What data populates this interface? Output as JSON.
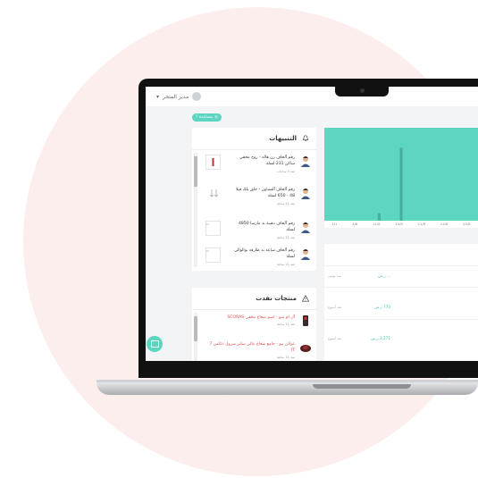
{
  "header": {
    "user_name": "مدير المتجر"
  },
  "badge": {
    "label": "مساعدة ؟"
  },
  "notifications": {
    "title": "التنبيهات",
    "items": [
      {
        "text": "رقم آلحاف رن هاله - روح مخفي ساكن 231 لسلة",
        "time": "منذ 4 ساعات"
      },
      {
        "text": "رقم آلحاف آلسباون - حلق بلك فيلا 48 - 650 لسلة",
        "time": "منذ 11 ساعة"
      },
      {
        "text": "رقم آلحاف دهيبة بد مازمبا 4850 لسلة",
        "time": "منذ 11 ساعة"
      },
      {
        "text": "رقم آلحاف ساعة بد طارقة بوالوالي لسلة",
        "time": "منذ 21 ساعة"
      }
    ]
  },
  "products": {
    "title": "منتجات نفدت",
    "items": [
      {
        "text": "آل ام ميو - اسم شعاع مخفي SCORAS",
        "time": "منذ 11 ساعة"
      },
      {
        "text": "عولان بيو - جامع شعاع عالي سلتر شرول ذلكس 7 IT",
        "time": "منذ 11 ساعة"
      }
    ]
  },
  "chart_data": {
    "type": "bar",
    "categories": [
      "1/1",
      "4/8",
      "11/8",
      "14/8",
      "21/8",
      "24/8",
      "25/8"
    ],
    "values": [
      0,
      0,
      1,
      10,
      0,
      0,
      0
    ],
    "ylim": [
      0,
      12
    ],
    "color": "#ffffff",
    "background": "#5dd6c1"
  },
  "feed": [
    {
      "label": "منذ يومين",
      "value": "... ر.س"
    },
    {
      "label": "منذ أسبوع",
      "value": "770 ر.س"
    },
    {
      "label": "منذ أسبوع",
      "value": "3,271 ر.س"
    }
  ],
  "colors": {
    "accent": "#5ad6c1",
    "alert_text": "#e05050"
  }
}
